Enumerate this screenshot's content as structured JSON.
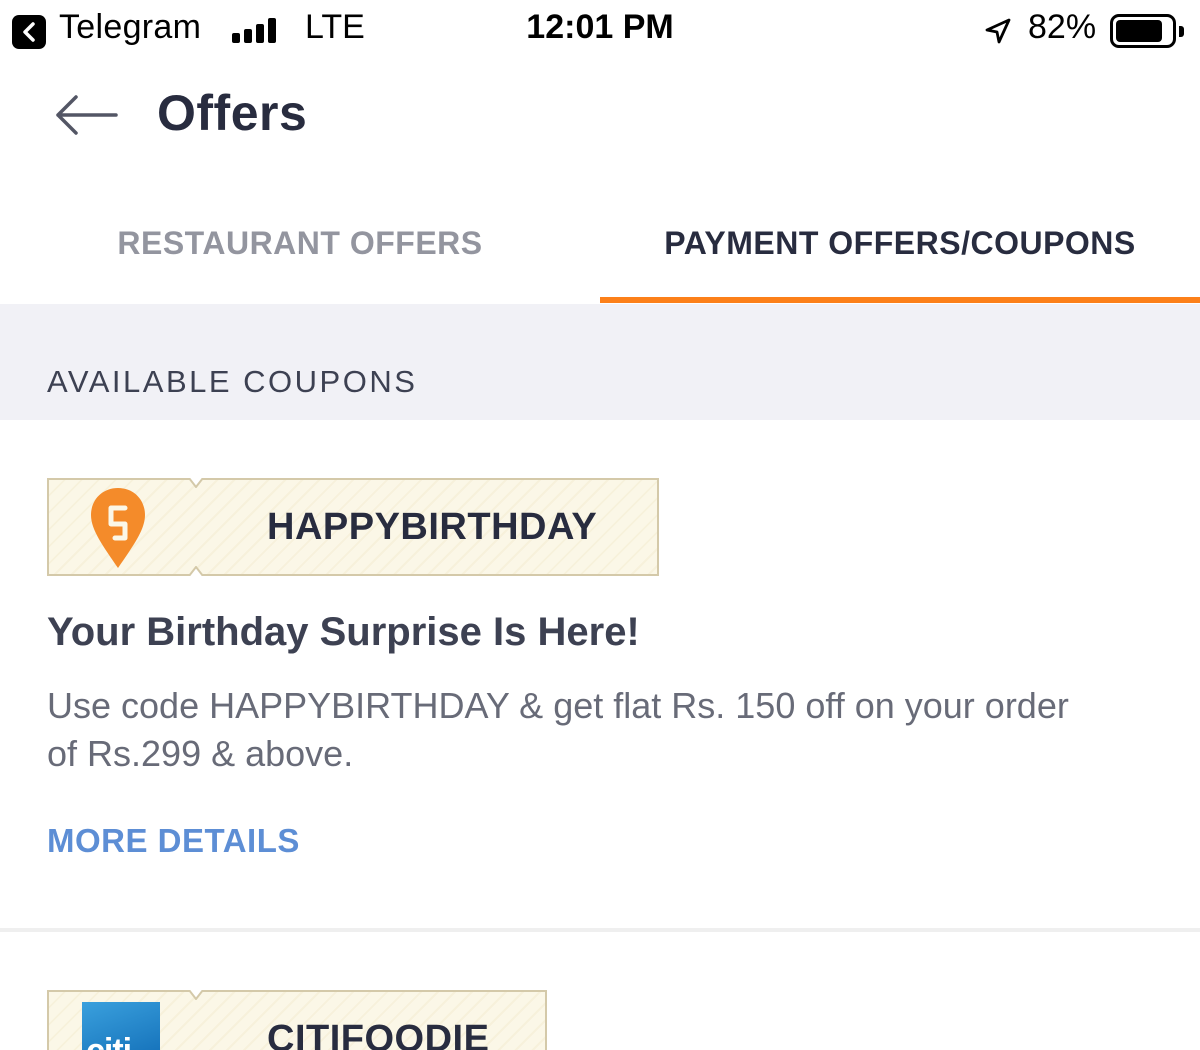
{
  "status_bar": {
    "back_app": "Telegram",
    "network": "LTE",
    "time": "12:01 PM",
    "battery": "82%",
    "icons": [
      "back-chevron-icon",
      "signal-icon",
      "location-arrow-icon",
      "battery-icon"
    ]
  },
  "header": {
    "title": "Offers",
    "back_icon": "arrow-left-icon"
  },
  "tabs": [
    {
      "label": "RESTAURANT OFFERS",
      "active": false
    },
    {
      "label": "PAYMENT OFFERS/COUPONS",
      "active": true
    }
  ],
  "section": {
    "title": "AVAILABLE COUPONS"
  },
  "coupons": [
    {
      "code": "HAPPYBIRTHDAY",
      "logo": "swiggy-logo",
      "title": "Your Birthday Surprise Is Here!",
      "description": "Use code HAPPYBIRTHDAY & get flat Rs. 150 off on your order of Rs.299 & above.",
      "link": "MORE DETAILS"
    },
    {
      "code": "CITIFOODIE",
      "logo": "citi-logo",
      "logo_text": "citi"
    }
  ],
  "colors": {
    "accent": "#fc8019",
    "link": "#5d8ed5",
    "text": "#282c3f",
    "muted": "#93959f",
    "section_bg": "#f1f1f6"
  }
}
